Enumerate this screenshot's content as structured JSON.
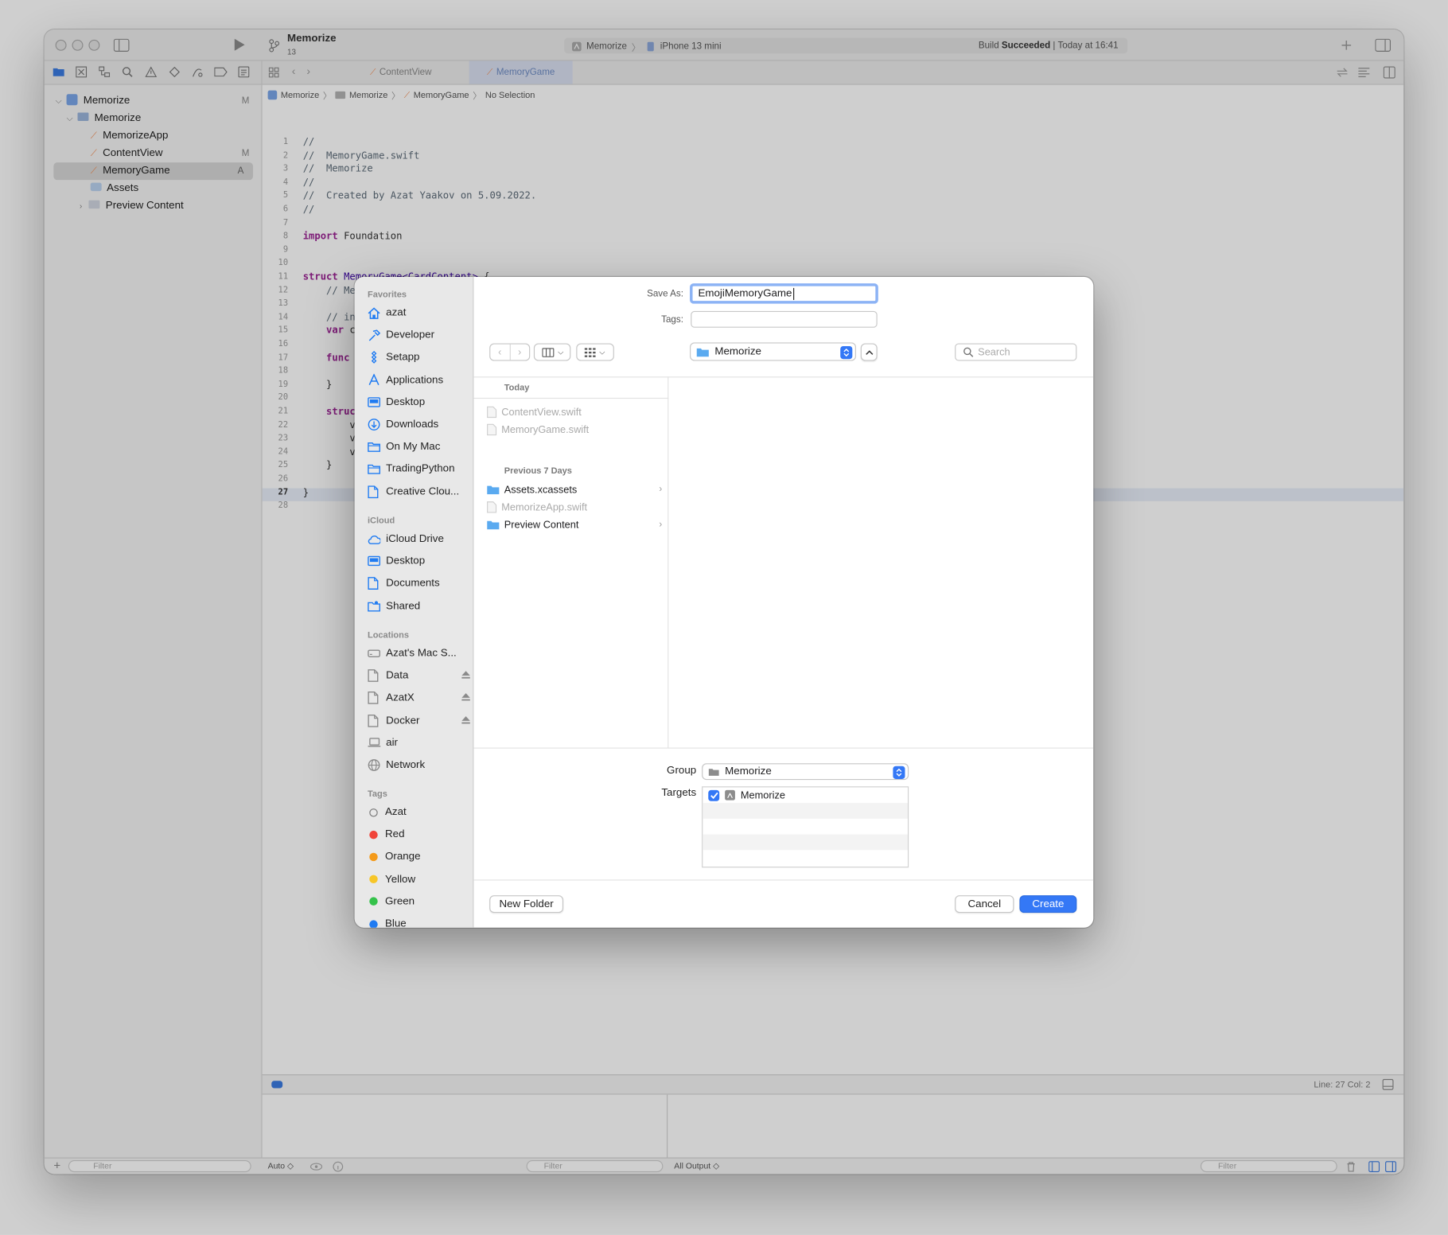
{
  "window": {
    "project": "Memorize",
    "branch": "13",
    "scheme": "Memorize",
    "destination": "iPhone 13 mini",
    "build_status_prefix": "Build",
    "build_status": "Succeeded",
    "build_time": "| Today at 16:41"
  },
  "editor_tabs": [
    {
      "label": "ContentView",
      "active": false
    },
    {
      "label": "MemoryGame",
      "active": true
    }
  ],
  "jump_bar": [
    "Memorize",
    "Memorize",
    "MemoryGame",
    "No Selection"
  ],
  "navigator": {
    "items": [
      {
        "label": "Memorize",
        "badge": "M"
      },
      {
        "label": "Memorize",
        "badge": ""
      },
      {
        "label": "MemorizeApp",
        "badge": ""
      },
      {
        "label": "ContentView",
        "badge": "M"
      },
      {
        "label": "MemoryGame",
        "badge": "A"
      },
      {
        "label": "Assets",
        "badge": ""
      },
      {
        "label": "Preview Content",
        "badge": ""
      }
    ],
    "filter_placeholder": "Filter"
  },
  "code": {
    "line_numbers": [
      "1",
      "2",
      "3",
      "4",
      "5",
      "6",
      "7",
      "8",
      "9",
      "10",
      "11",
      "12",
      "13",
      "14",
      "15",
      "16",
      "17",
      "18",
      "19",
      "20",
      "21",
      "22",
      "23",
      "24",
      "25",
      "26",
      "27",
      "28"
    ],
    "l1": "//",
    "l2": "//  MemoryGame.swift",
    "l3": "//  Memorize",
    "l4": "//",
    "l5": "//  Created by Azat Yaakov on 5.09.2022.",
    "l6": "//",
    "l8_kw": "import",
    "l8_rest": " Foundation",
    "l11_kw": "struct",
    "l11_type": " MemoryGame<CardContent>",
    "l11_rest": " {",
    "l12": "    // Memorize Game's state and controller.",
    "l14": "    // in",
    "l15_kw": "    var",
    "l15_rest": " c",
    "l17_kw": "    func",
    "l19": "    }",
    "l21_kw": "    struc",
    "l22": "        v",
    "l23": "        v",
    "l24": "        v",
    "l25": "    }",
    "l27": "}"
  },
  "status": {
    "cursor": "Line: 27  Col: 2",
    "auto": "Auto ◇",
    "all_output": "All Output ◇",
    "filter": "Filter"
  },
  "dialog": {
    "save_as_label": "Save As:",
    "save_as_value": "EmojiMemoryGame",
    "tags_label": "Tags:",
    "tags_value": "",
    "location": "Memorize",
    "search_placeholder": "Search",
    "sidebar": {
      "favorites_header": "Favorites",
      "favorites": [
        {
          "label": "azat",
          "icon": "house-icon"
        },
        {
          "label": "Developer",
          "icon": "hammer-icon"
        },
        {
          "label": "Setapp",
          "icon": "setapp-icon"
        },
        {
          "label": "Applications",
          "icon": "applications-icon"
        },
        {
          "label": "Desktop",
          "icon": "desktop-icon"
        },
        {
          "label": "Downloads",
          "icon": "downloads-icon"
        },
        {
          "label": "On My Mac",
          "icon": "folder-icon"
        },
        {
          "label": "TradingPython",
          "icon": "folder-icon"
        },
        {
          "label": "Creative Clou...",
          "icon": "document-icon"
        }
      ],
      "icloud_header": "iCloud",
      "icloud": [
        {
          "label": "iCloud Drive",
          "icon": "cloud-icon"
        },
        {
          "label": "Desktop",
          "icon": "desktop-icon"
        },
        {
          "label": "Documents",
          "icon": "document-icon"
        },
        {
          "label": "Shared",
          "icon": "shared-folder-icon"
        }
      ],
      "locations_header": "Locations",
      "locations": [
        {
          "label": "Azat's Mac S...",
          "icon": "drive-icon",
          "eject": false
        },
        {
          "label": "Data",
          "icon": "document-icon",
          "eject": true
        },
        {
          "label": "AzatX",
          "icon": "document-icon",
          "eject": true
        },
        {
          "label": "Docker",
          "icon": "document-icon",
          "eject": true
        },
        {
          "label": "air",
          "icon": "laptop-icon",
          "eject": false
        },
        {
          "label": "Network",
          "icon": "globe-icon",
          "eject": false
        }
      ],
      "tags_header": "Tags",
      "tags": [
        {
          "label": "Azat",
          "color": ""
        },
        {
          "label": "Red",
          "color": "#f0443a"
        },
        {
          "label": "Orange",
          "color": "#f49a1a"
        },
        {
          "label": "Yellow",
          "color": "#f7c628"
        },
        {
          "label": "Green",
          "color": "#34c24a"
        },
        {
          "label": "Blue",
          "color": "#1f7bf2"
        }
      ]
    },
    "files": {
      "today_header": "Today",
      "today": [
        {
          "label": "ContentView.swift",
          "kind": "file",
          "enabled": false
        },
        {
          "label": "MemoryGame.swift",
          "kind": "file",
          "enabled": false
        }
      ],
      "previous_header": "Previous 7 Days",
      "previous": [
        {
          "label": "Assets.xcassets",
          "kind": "folder",
          "enabled": true
        },
        {
          "label": "MemorizeApp.swift",
          "kind": "file",
          "enabled": false
        },
        {
          "label": "Preview Content",
          "kind": "folder",
          "enabled": true
        }
      ]
    },
    "group_label": "Group",
    "group_value": "Memorize",
    "targets_label": "Targets",
    "targets": [
      {
        "label": "Memorize",
        "checked": true
      }
    ],
    "new_folder": "New Folder",
    "cancel": "Cancel",
    "create": "Create",
    "accent": "#3478f6"
  }
}
